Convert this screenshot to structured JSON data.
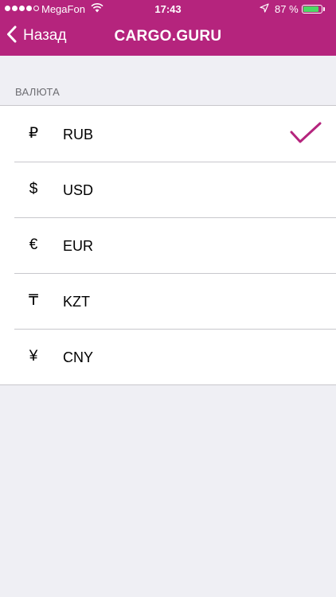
{
  "status_bar": {
    "carrier": "MegaFon",
    "time": "17:43",
    "battery_percent": "87 %",
    "battery_level": 0.87,
    "signal_bars_filled": 4,
    "signal_bars_total": 5
  },
  "nav": {
    "back_label": "Назад",
    "title": "CARGO.GURU",
    "back_icon": "chevron-left-icon"
  },
  "section": {
    "title": "ВАЛЮТА"
  },
  "currencies": [
    {
      "symbol": "₽",
      "code": "RUB",
      "selected": true
    },
    {
      "symbol": "$",
      "code": "USD",
      "selected": false
    },
    {
      "symbol": "€",
      "code": "EUR",
      "selected": false
    },
    {
      "symbol": "₸",
      "code": "KZT",
      "selected": false
    },
    {
      "symbol": "¥",
      "code": "CNY",
      "selected": false
    }
  ],
  "colors": {
    "header": "#b5247d",
    "accent": "#b5247d",
    "background": "#efeff4",
    "battery": "#4cd964"
  }
}
